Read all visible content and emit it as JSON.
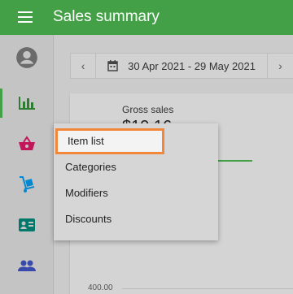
{
  "app_bar": {
    "title": "Sales summary",
    "color": "#43a047",
    "menu_icon": "hamburger-icon"
  },
  "nav_rail": {
    "items": [
      {
        "icon": "account-icon",
        "label": "Account",
        "active": false
      },
      {
        "icon": "bar-chart-icon",
        "label": "Reports",
        "active": true
      },
      {
        "icon": "basket-icon",
        "label": "Items",
        "active": false
      },
      {
        "icon": "hand-truck-icon",
        "label": "Inventory",
        "active": false
      },
      {
        "icon": "id-card-icon",
        "label": "Employees",
        "active": false
      },
      {
        "icon": "people-icon",
        "label": "Customers",
        "active": false
      }
    ]
  },
  "date_bar": {
    "prev_icon": "chevron-left-icon",
    "calendar_icon": "calendar-icon",
    "range": "30 Apr 2021 - 29 May 2021",
    "next_icon": "chevron-right-icon"
  },
  "summary": {
    "gross_sales_label": "Gross sales",
    "gross_sales_value": "$19.16",
    "axis_tick": "400.00"
  },
  "items_menu": {
    "items": [
      {
        "label": "Item list",
        "highlighted": true
      },
      {
        "label": "Categories",
        "highlighted": false
      },
      {
        "label": "Modifiers",
        "highlighted": false
      },
      {
        "label": "Discounts",
        "highlighted": false
      }
    ],
    "highlight_color": "#f0873a"
  }
}
